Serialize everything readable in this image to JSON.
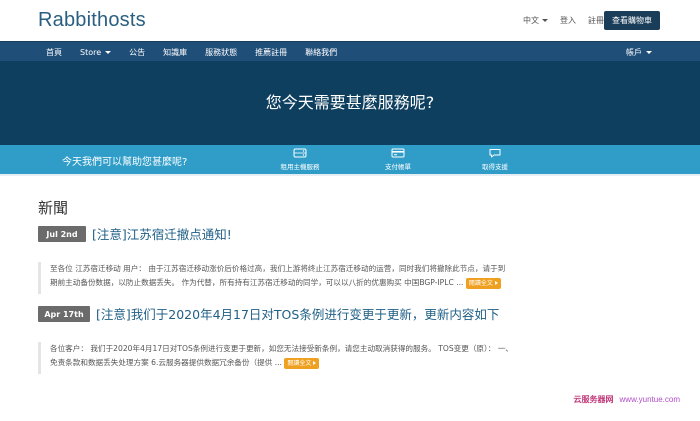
{
  "header": {
    "logo": "Rabbithosts",
    "language": "中文",
    "login": "登入",
    "register": "註冊",
    "cart_button": "查看購物車"
  },
  "nav": {
    "items": [
      {
        "label": "首頁"
      },
      {
        "label": "Store"
      },
      {
        "label": "公告"
      },
      {
        "label": "知識庫"
      },
      {
        "label": "服務狀態"
      },
      {
        "label": "推薦註冊"
      },
      {
        "label": "聯絡我們"
      }
    ],
    "account": "帳戶"
  },
  "hero": {
    "title": "您今天需要甚麼服務呢?"
  },
  "help": {
    "text": "今天我們可以幫助您甚麼呢?",
    "items": [
      {
        "label": "租用主機服務",
        "icon": "server-icon"
      },
      {
        "label": "支付帳單",
        "icon": "credit-card-icon"
      },
      {
        "label": "取得支援",
        "icon": "chat-bubble-icon"
      }
    ]
  },
  "news": {
    "heading": "新聞",
    "posts": [
      {
        "date": "Jul 2nd",
        "title": "[注意]江苏宿迁撤点通知!",
        "snippet_line1": "至各位 江苏宿迁移动 用户： 由于江苏宿迁移动涨价后价格过高，我们上游将终止江苏宿迁移动的运营，同时我们将撤除此节点，请于到",
        "snippet_line2": "期前主动备份数据，以防止数据丢失。 作为代替，所有持有江苏宿迁移动的同学，可以以八折的优惠购买 中国BGP-IPLC ...",
        "more": "閱讀全文"
      },
      {
        "date": "Apr 17th",
        "title": "[注意]我们于2020年4月17日对TOS条例进行变更于更新，更新内容如下",
        "snippet_line1": "各位客户： 我们于2020年4月17日对TOS条例进行变更于更新，如您无法接受新条例，请您主动取消获得的服务。 TOS变更（原）： 一、",
        "snippet_line2": "免责条款和数据丢失处理方案 6.云服务器提供数据冗余备份（提供 ...",
        "more": "閱讀全文"
      }
    ]
  },
  "watermark": {
    "cn": "云服务器网",
    "url": "www.yuntue.com"
  },
  "colors": {
    "nav_bg": "#1f4e79",
    "hero_bg": "#0e3f5f",
    "help_band": "#2f9dc8",
    "link": "#1f5f86",
    "read_more": "#f0a020",
    "date_tag": "#6b6b6b"
  }
}
